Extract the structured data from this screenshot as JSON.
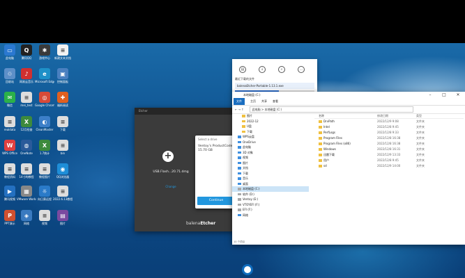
{
  "desktop_icons": [
    {
      "label": "此电脑",
      "color": "#2a78d0",
      "glyph": "▭"
    },
    {
      "label": "腾讯QQ",
      "color": "#222222",
      "glyph": "Q"
    },
    {
      "label": "游戏中心",
      "color": "#3a3a3a",
      "glyph": "✱"
    },
    {
      "label": "新建文本文档",
      "color": "#f2f2f2",
      "glyph": "≡"
    },
    {
      "label": "回收站",
      "color": "#5d8fc8",
      "glyph": "♲"
    },
    {
      "label": "网易云音乐",
      "color": "#d03030",
      "glyph": "♪"
    },
    {
      "label": "Microsoft Edge",
      "color": "#1e90c8",
      "glyph": "e"
    },
    {
      "label": "控制面板",
      "color": "#4a80c0",
      "glyph": "▣"
    },
    {
      "label": "微信",
      "color": "#2bb14a",
      "glyph": "✉"
    },
    {
      "label": "mei_test",
      "color": "#dddddd",
      "glyph": "≡"
    },
    {
      "label": "Google Chrome",
      "color": "#d84a38",
      "glyph": "◎"
    },
    {
      "label": "福昕阅读",
      "color": "#e06020",
      "glyph": "✚"
    },
    {
      "label": "realdata",
      "color": "#dddddd",
      "glyph": "≡"
    },
    {
      "label": "12月检查",
      "color": "#3d8a3d",
      "glyph": "X"
    },
    {
      "label": "CleanMaster",
      "color": "#3c7fc8",
      "glyph": "◐"
    },
    {
      "label": "下载",
      "color": "#dddddd",
      "glyph": "≡"
    },
    {
      "label": "WPS Office",
      "color": "#e04040",
      "glyph": "W"
    },
    {
      "label": "OneNote",
      "color": "#2a5a9a",
      "glyph": "◍"
    },
    {
      "label": "1.7统计",
      "color": "#3d8a3d",
      "glyph": "X"
    },
    {
      "label": "bin",
      "color": "#dddddd",
      "glyph": "≡"
    },
    {
      "label": "教程资料",
      "color": "#dddddd",
      "glyph": "≡"
    },
    {
      "label": "14寸的教程",
      "color": "#dddddd",
      "glyph": "≡"
    },
    {
      "label": "教程图片",
      "color": "#dddddd",
      "glyph": "≡"
    },
    {
      "label": "QQ浏览器",
      "color": "#1e8ed8",
      "glyph": "◉"
    },
    {
      "label": "腾讯视频",
      "color": "#2470c0",
      "glyph": "▶"
    },
    {
      "label": "VMware Workstation",
      "color": "#888888",
      "glyph": "▦"
    },
    {
      "label": "向日葵远程",
      "color": "#2a7ac8",
      "glyph": "☼"
    },
    {
      "label": "2022.6.13教程",
      "color": "#dddddd",
      "glyph": "≡"
    },
    {
      "label": "PPT演示",
      "color": "#d05030",
      "glyph": "P"
    },
    {
      "label": "网络",
      "color": "#3a7ac0",
      "glyph": "◈"
    },
    {
      "label": "视频",
      "color": "#dddddd",
      "glyph": "≡"
    },
    {
      "label": "图片",
      "color": "#7a4aa0",
      "glyph": "▤"
    }
  ],
  "etcher": {
    "title": "Etcher",
    "file_name": "USB.Flash...20.71.dmg",
    "change": "Change",
    "brand_a": "balena",
    "brand_b": "Etcher",
    "dialog_title": "Select a drive",
    "dialog_text": "Ventoy’s ProductCode 15.70 GB",
    "dialog_button": "Continue"
  },
  "downloads": {
    "header": "最近下载的文件",
    "file": "balenaEtcher-Portable-1.13.1.exe",
    "progress": 0.55
  },
  "explorer": {
    "title": "本地磁盘 (C:)",
    "ribbon": [
      "文件",
      "主页",
      "共享",
      "查看"
    ],
    "address": "此电脑 > 本地磁盘 (C:)",
    "nav": [
      {
        "label": "图片",
        "type": "folder"
      },
      {
        "label": "2022-12",
        "type": "folder"
      },
      {
        "label": "U盘",
        "type": "folder"
      },
      {
        "label": "下载",
        "type": "folder"
      },
      {
        "label": "WPS云盘",
        "type": "blue"
      },
      {
        "label": "OneDrive",
        "type": "blue"
      },
      {
        "label": "此电脑",
        "type": "blue"
      },
      {
        "label": "3D 对象",
        "type": "blue"
      },
      {
        "label": "视频",
        "type": "blue"
      },
      {
        "label": "图片",
        "type": "blue"
      },
      {
        "label": "文档",
        "type": "blue"
      },
      {
        "label": "下载",
        "type": "blue"
      },
      {
        "label": "音乐",
        "type": "blue"
      },
      {
        "label": "桌面",
        "type": "blue"
      },
      {
        "label": "本地磁盘 (C:)",
        "type": "gray",
        "selected": true
      },
      {
        "label": "软件 (D:)",
        "type": "gray"
      },
      {
        "label": "Ventoy (E:)",
        "type": "gray"
      },
      {
        "label": "VTOYEFI (F:)",
        "type": "gray"
      },
      {
        "label": "EFI (F:)",
        "type": "gray"
      },
      {
        "label": "网络",
        "type": "blue"
      }
    ],
    "columns": [
      "名称",
      "修改日期",
      "类型"
    ],
    "rows": [
      {
        "name": "DrvPath",
        "date": "2022/12/9 9:08",
        "type": "文件夹"
      },
      {
        "name": "Intel",
        "date": "2022/12/8 9:45",
        "type": "文件夹"
      },
      {
        "name": "PerfLogs",
        "date": "2022/12/8 9:33",
        "type": "文件夹"
      },
      {
        "name": "Program Files",
        "date": "2022/12/8 16:38",
        "type": "文件夹"
      },
      {
        "name": "Program Files (x86)",
        "date": "2022/12/8 16:38",
        "type": "文件夹"
      },
      {
        "name": "Windows",
        "date": "2022/12/8 16:31",
        "type": "文件夹"
      },
      {
        "name": "迅雷下载",
        "date": "2022/12/9 13:33",
        "type": "文件夹"
      },
      {
        "name": "用户",
        "date": "2022/12/8 9:45",
        "type": "文件夹"
      },
      {
        "name": "sd",
        "date": "2022/12/9 14:00",
        "type": "文件夹"
      }
    ],
    "status": "10 个项目"
  }
}
